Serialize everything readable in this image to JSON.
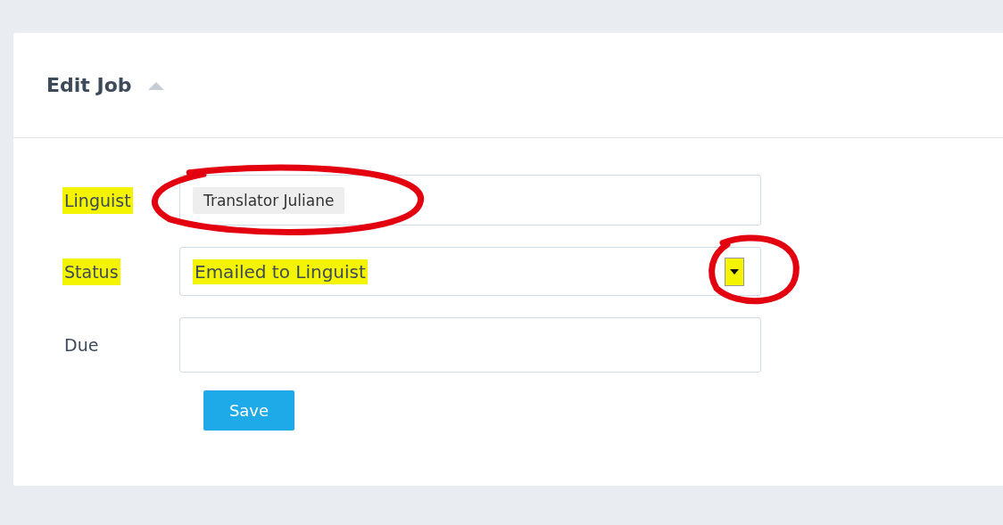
{
  "card": {
    "title": "Edit Job",
    "collapse_expanded": true
  },
  "fields": [
    {
      "kind": "chips",
      "label": "Linguist",
      "label_highlighted": true,
      "value": "Translator Juliane",
      "value_highlighted": false,
      "value_circled": true
    },
    {
      "kind": "select",
      "label": "Status",
      "label_highlighted": true,
      "value": "Emailed to Linguist",
      "value_highlighted": true,
      "arrow_highlighted": true,
      "arrow_circled": true
    },
    {
      "kind": "text",
      "label": "Due",
      "label_highlighted": false
    }
  ],
  "buttons": [
    {
      "label": "Save"
    }
  ]
}
